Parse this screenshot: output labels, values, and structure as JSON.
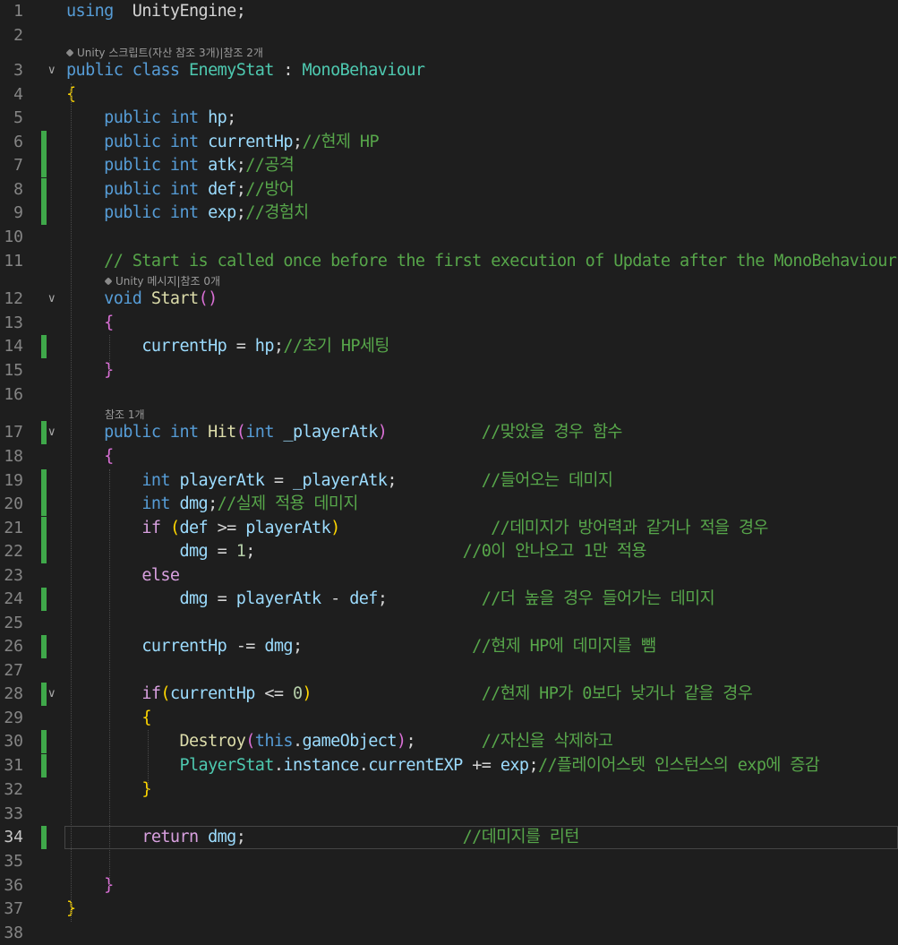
{
  "window": {
    "language": "C#",
    "file_class": "EnemyStat"
  },
  "code_lens": {
    "class_lens": "Unity 스크립트(자산 참조 3개)|참조 2개",
    "start_lens": "Unity 메시지|참조 0개",
    "hit_lens": "참조 1개"
  },
  "lines": [
    {
      "n": "1",
      "t": [
        [
          "kw",
          "using"
        ],
        [
          "",
          "  UnityEngine;"
        ]
      ]
    },
    {
      "n": "2",
      "t": []
    },
    {
      "n": "3",
      "t": [
        [
          "kw",
          "public class "
        ],
        [
          "ty",
          "EnemyStat"
        ],
        [
          "",
          " : "
        ],
        [
          "ty",
          "MonoBehaviour"
        ]
      ]
    },
    {
      "n": "4",
      "t": [
        [
          "br1",
          "{"
        ]
      ]
    },
    {
      "n": "5",
      "t": [
        [
          "",
          "    "
        ],
        [
          "kw",
          "public int "
        ],
        [
          "vr",
          "hp"
        ],
        [
          "",
          ";"
        ]
      ]
    },
    {
      "n": "6",
      "t": [
        [
          "",
          "    "
        ],
        [
          "kw",
          "public int "
        ],
        [
          "vr",
          "currentHp"
        ],
        [
          "",
          ";"
        ],
        [
          "cm",
          "//현제 HP"
        ]
      ]
    },
    {
      "n": "7",
      "t": [
        [
          "",
          "    "
        ],
        [
          "kw",
          "public int "
        ],
        [
          "vr",
          "atk"
        ],
        [
          "",
          ";"
        ],
        [
          "cm",
          "//공격"
        ]
      ]
    },
    {
      "n": "8",
      "t": [
        [
          "",
          "    "
        ],
        [
          "kw",
          "public int "
        ],
        [
          "vr",
          "def"
        ],
        [
          "",
          ";"
        ],
        [
          "cm",
          "//방어"
        ]
      ]
    },
    {
      "n": "9",
      "t": [
        [
          "",
          "    "
        ],
        [
          "kw",
          "public int "
        ],
        [
          "vr",
          "exp"
        ],
        [
          "",
          ";"
        ],
        [
          "cm",
          "//경험치"
        ]
      ]
    },
    {
      "n": "10",
      "t": []
    },
    {
      "n": "11",
      "t": [
        [
          "",
          "    "
        ],
        [
          "cm",
          "// Start is called once before the first execution of Update after the MonoBehaviour"
        ]
      ]
    },
    {
      "n": "12",
      "t": [
        [
          "",
          "    "
        ],
        [
          "kw",
          "void "
        ],
        [
          "fn",
          "Start"
        ],
        [
          "br2",
          "()"
        ]
      ]
    },
    {
      "n": "13",
      "t": [
        [
          "",
          "    "
        ],
        [
          "br2",
          "{"
        ]
      ]
    },
    {
      "n": "14",
      "t": [
        [
          "",
          "        "
        ],
        [
          "vr",
          "currentHp"
        ],
        [
          "",
          " = "
        ],
        [
          "vr",
          "hp"
        ],
        [
          "",
          ";"
        ],
        [
          "cm",
          "//초기 HP세팅"
        ]
      ]
    },
    {
      "n": "15",
      "t": [
        [
          "",
          "    "
        ],
        [
          "br2",
          "}"
        ]
      ]
    },
    {
      "n": "16",
      "t": []
    },
    {
      "n": "17",
      "t": [
        [
          "",
          "    "
        ],
        [
          "kw",
          "public int "
        ],
        [
          "fn",
          "Hit"
        ],
        [
          "br2",
          "("
        ],
        [
          "kw",
          "int "
        ],
        [
          "vr",
          "_playerAtk"
        ],
        [
          "br2",
          ")"
        ],
        [
          "",
          "          "
        ],
        [
          "cm",
          "//맞았을 경우 함수"
        ]
      ]
    },
    {
      "n": "18",
      "t": [
        [
          "",
          "    "
        ],
        [
          "br2",
          "{"
        ]
      ]
    },
    {
      "n": "19",
      "t": [
        [
          "",
          "        "
        ],
        [
          "kw",
          "int "
        ],
        [
          "vr",
          "playerAtk"
        ],
        [
          "",
          " = "
        ],
        [
          "vr",
          "_playerAtk"
        ],
        [
          "",
          ";"
        ],
        [
          "",
          "         "
        ],
        [
          "cm",
          "//들어오는 데미지"
        ]
      ]
    },
    {
      "n": "20",
      "t": [
        [
          "",
          "        "
        ],
        [
          "kw",
          "int "
        ],
        [
          "vr",
          "dmg"
        ],
        [
          "",
          ";"
        ],
        [
          "cm",
          "//실제 적용 데미지"
        ]
      ]
    },
    {
      "n": "21",
      "t": [
        [
          "",
          "        "
        ],
        [
          "ctl",
          "if "
        ],
        [
          "br1",
          "("
        ],
        [
          "vr",
          "def"
        ],
        [
          "",
          " >= "
        ],
        [
          "vr",
          "playerAtk"
        ],
        [
          "br1",
          ")"
        ],
        [
          "",
          "                "
        ],
        [
          "cm",
          "//데미지가 방어력과 같거나 적을 경우"
        ]
      ]
    },
    {
      "n": "22",
      "t": [
        [
          "",
          "            "
        ],
        [
          "vr",
          "dmg"
        ],
        [
          "",
          " = "
        ],
        [
          "nm",
          "1"
        ],
        [
          "",
          ";"
        ],
        [
          "",
          "                      "
        ],
        [
          "cm",
          "//0이 안나오고 1만 적용"
        ]
      ]
    },
    {
      "n": "23",
      "t": [
        [
          "",
          "        "
        ],
        [
          "ctl",
          "else"
        ]
      ]
    },
    {
      "n": "24",
      "t": [
        [
          "",
          "            "
        ],
        [
          "vr",
          "dmg"
        ],
        [
          "",
          " = "
        ],
        [
          "vr",
          "playerAtk"
        ],
        [
          "",
          " - "
        ],
        [
          "vr",
          "def"
        ],
        [
          "",
          ";"
        ],
        [
          "",
          "          "
        ],
        [
          "cm",
          "//더 높을 경우 들어가는 데미지"
        ]
      ]
    },
    {
      "n": "25",
      "t": []
    },
    {
      "n": "26",
      "t": [
        [
          "",
          "        "
        ],
        [
          "vr",
          "currentHp"
        ],
        [
          "",
          " -= "
        ],
        [
          "vr",
          "dmg"
        ],
        [
          "",
          ";"
        ],
        [
          "",
          "                  "
        ],
        [
          "cm",
          "//현제 HP에 데미지를 뺌"
        ]
      ]
    },
    {
      "n": "27",
      "t": []
    },
    {
      "n": "28",
      "t": [
        [
          "",
          "        "
        ],
        [
          "ctl",
          "if"
        ],
        [
          "br1",
          "("
        ],
        [
          "vr",
          "currentHp"
        ],
        [
          "",
          " <= "
        ],
        [
          "nm",
          "0"
        ],
        [
          "br1",
          ")"
        ],
        [
          "",
          "                  "
        ],
        [
          "cm",
          "//현제 HP가 0보다 낮거나 같을 경우"
        ]
      ]
    },
    {
      "n": "29",
      "t": [
        [
          "",
          "        "
        ],
        [
          "br1",
          "{"
        ]
      ]
    },
    {
      "n": "30",
      "t": [
        [
          "",
          "            "
        ],
        [
          "fn",
          "Destroy"
        ],
        [
          "br2",
          "("
        ],
        [
          "kw",
          "this"
        ],
        [
          "",
          "."
        ],
        [
          "vr",
          "gameObject"
        ],
        [
          "br2",
          ")"
        ],
        [
          "",
          ";"
        ],
        [
          "",
          "       "
        ],
        [
          "cm",
          "//자신을 삭제하고"
        ]
      ]
    },
    {
      "n": "31",
      "t": [
        [
          "",
          "            "
        ],
        [
          "ty",
          "PlayerStat"
        ],
        [
          "",
          "."
        ],
        [
          "vr",
          "instance"
        ],
        [
          "",
          "."
        ],
        [
          "vr",
          "currentEXP"
        ],
        [
          "",
          " += "
        ],
        [
          "vr",
          "exp"
        ],
        [
          "",
          ";"
        ],
        [
          "cm",
          "//플레이어스텟 인스턴스의 exp에 증감"
        ]
      ]
    },
    {
      "n": "32",
      "t": [
        [
          "",
          "        "
        ],
        [
          "br1",
          "}"
        ]
      ]
    },
    {
      "n": "33",
      "t": []
    },
    {
      "n": "34",
      "t": [
        [
          "",
          "        "
        ],
        [
          "ctl",
          "return "
        ],
        [
          "vr",
          "dmg"
        ],
        [
          "",
          ";"
        ],
        [
          "",
          "                       "
        ],
        [
          "cm",
          "//데미지를 리턴"
        ]
      ]
    },
    {
      "n": "35",
      "t": []
    },
    {
      "n": "36",
      "t": [
        [
          "",
          "    "
        ],
        [
          "br2",
          "}"
        ]
      ]
    },
    {
      "n": "37",
      "t": [
        [
          "br1",
          "}"
        ]
      ]
    },
    {
      "n": "38",
      "t": []
    }
  ],
  "changed_lines": [
    "6",
    "7",
    "8",
    "9",
    "14",
    "17",
    "19",
    "20",
    "21",
    "22",
    "24",
    "26",
    "28",
    "30",
    "31",
    "34"
  ],
  "fold_lines": [
    "3",
    "12",
    "17",
    "28"
  ],
  "active_line": "34",
  "colors": {
    "background": "#1e1e1e",
    "keyword": "#569cd6",
    "type": "#4ec9b0",
    "method": "#dcdcaa",
    "variable": "#9cdcfe",
    "comment": "#57a64a",
    "number": "#b5cea8",
    "control": "#d8a0df",
    "change_bar": "#3fa84a"
  }
}
